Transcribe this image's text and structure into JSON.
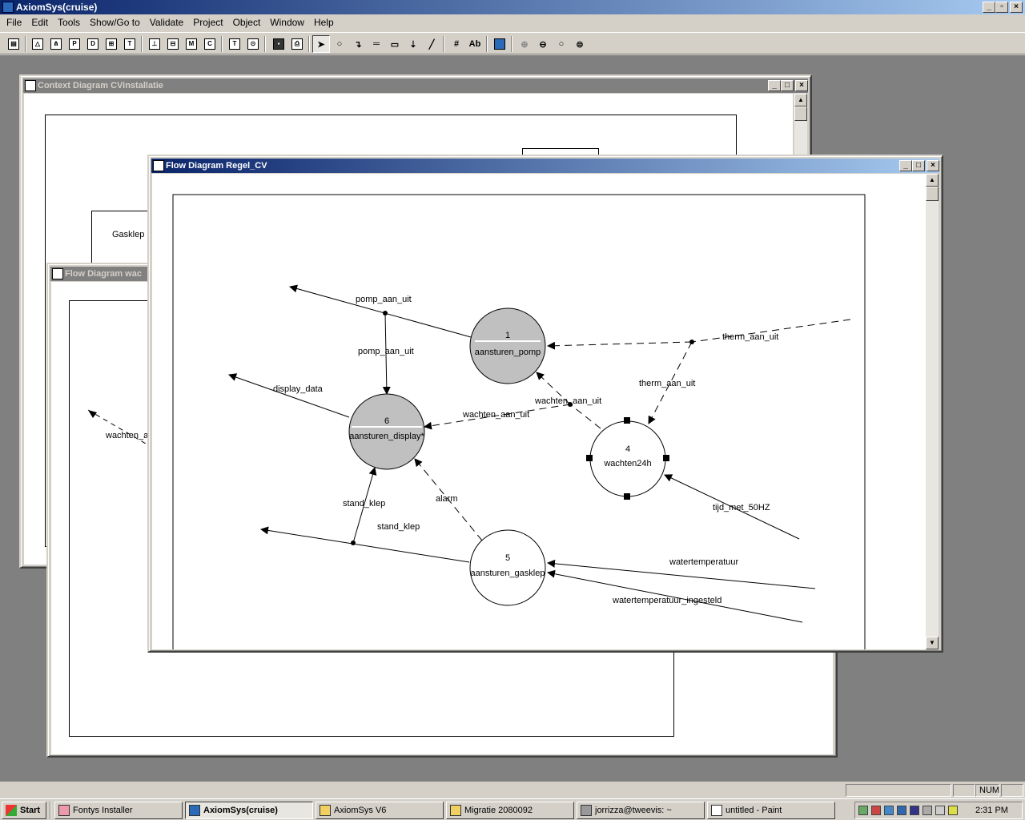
{
  "app": {
    "title": "AxiomSys(cruise)"
  },
  "menu": [
    "File",
    "Edit",
    "Tools",
    "Show/Go to",
    "Validate",
    "Project",
    "Object",
    "Window",
    "Help"
  ],
  "toolbar": {
    "ab_label": "Ab"
  },
  "windows": {
    "context": {
      "title": "Context Diagram CVinstallatie",
      "labels": {
        "gasklep": "Gasklep"
      }
    },
    "flow_back": {
      "title": "Flow Diagram wac",
      "labels": {
        "wachten": "wachten_aan"
      }
    },
    "flow_front": {
      "title": "Flow Diagram Regel_CV",
      "processes": [
        {
          "num": "1",
          "name": "aansturen_pomp"
        },
        {
          "num": "6",
          "name": "aansturen_display*"
        },
        {
          "num": "4",
          "name": "wachten24h"
        },
        {
          "num": "5",
          "name": "aansturen_gasklep"
        }
      ],
      "flows": {
        "pomp_aan_uit_top": "pomp_aan_uit",
        "pomp_aan_uit_mid": "pomp_aan_uit",
        "display_data": "display_data",
        "therm_aan_uit_right": "therm_aan_uit",
        "therm_aan_uit_mid": "therm_aan_uit",
        "wachten_aan_uit_a": "wachten_aan_uit",
        "wachten_aan_uit_b": "wachten_aan_uit",
        "tijd_met_50hz": "tijd_met_50HZ",
        "stand_klep_a": "stand_klep",
        "stand_klep_b": "stand_klep",
        "alarm": "alarm",
        "watertemperatuur": "watertemperatuur",
        "watertemperatuur_ingesteld": "watertemperatuur_ingesteld"
      }
    }
  },
  "statusbar": {
    "num": "NUM"
  },
  "taskbar": {
    "start": "Start",
    "items": [
      "Fontys Installer",
      "AxiomSys(cruise)",
      "AxiomSys V6",
      "Migratie 2080092",
      "jorrizza@tweevis: ~",
      "untitled - Paint"
    ],
    "clock": "2:31 PM"
  }
}
